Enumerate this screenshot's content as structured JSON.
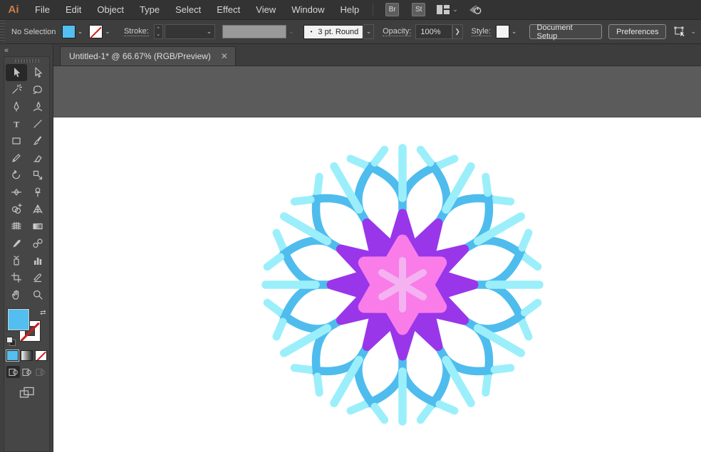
{
  "app": {
    "logo_text": "Ai"
  },
  "menubar": {
    "items": [
      "File",
      "Edit",
      "Object",
      "Type",
      "Select",
      "Effect",
      "View",
      "Window",
      "Help"
    ],
    "bridge_button": "Br",
    "stock_button": "St",
    "workspace_icon": "workspace-switcher-icon",
    "share_icon": "share-power-icon",
    "chevron": "⌄"
  },
  "controlbar": {
    "selection_status": "No Selection",
    "stroke_label": "Stroke:",
    "spinner_up": "⌃",
    "spinner_down": "⌄",
    "brush_bullet": "•",
    "brush_name": "3 pt. Round",
    "opacity_label": "Opacity:",
    "opacity_value": "100%",
    "opacity_arrow": "❯",
    "style_label": "Style:",
    "document_setup_button": "Document Setup",
    "preferences_button": "Preferences",
    "chevron": "⌄"
  },
  "tabbar": {
    "title": "Untitled-1* @ 66.67% (RGB/Preview)",
    "close_glyph": "✕"
  },
  "toolbar": {
    "collapse_glyph": "«",
    "swap_glyph": "⇄",
    "active_tool": "selection",
    "tools": [
      "selection",
      "direct-selection",
      "magic-wand",
      "lasso",
      "pen",
      "curvature",
      "type",
      "line-segment",
      "rectangle",
      "paintbrush",
      "shaper",
      "eraser",
      "rotate",
      "scale",
      "width",
      "puppet-warp",
      "shape-builder",
      "perspective-grid",
      "mesh",
      "gradient",
      "eyedropper",
      "blend",
      "symbol-sprayer",
      "column-graph",
      "artboard",
      "slice",
      "hand",
      "zoom"
    ]
  },
  "colors": {
    "fill_swatch": "#52BFF0",
    "logo_orange": "#C9804A"
  },
  "canvas": {
    "zoom_percent": "66.67%",
    "snowflake": {
      "branch_blue": "#4FBCEE",
      "branch_cyan": "#9BEFFB",
      "star_purple": "#9A36E9",
      "star_pink": "#F97CE9",
      "asterisk_pink": "#F4B2F0"
    }
  }
}
